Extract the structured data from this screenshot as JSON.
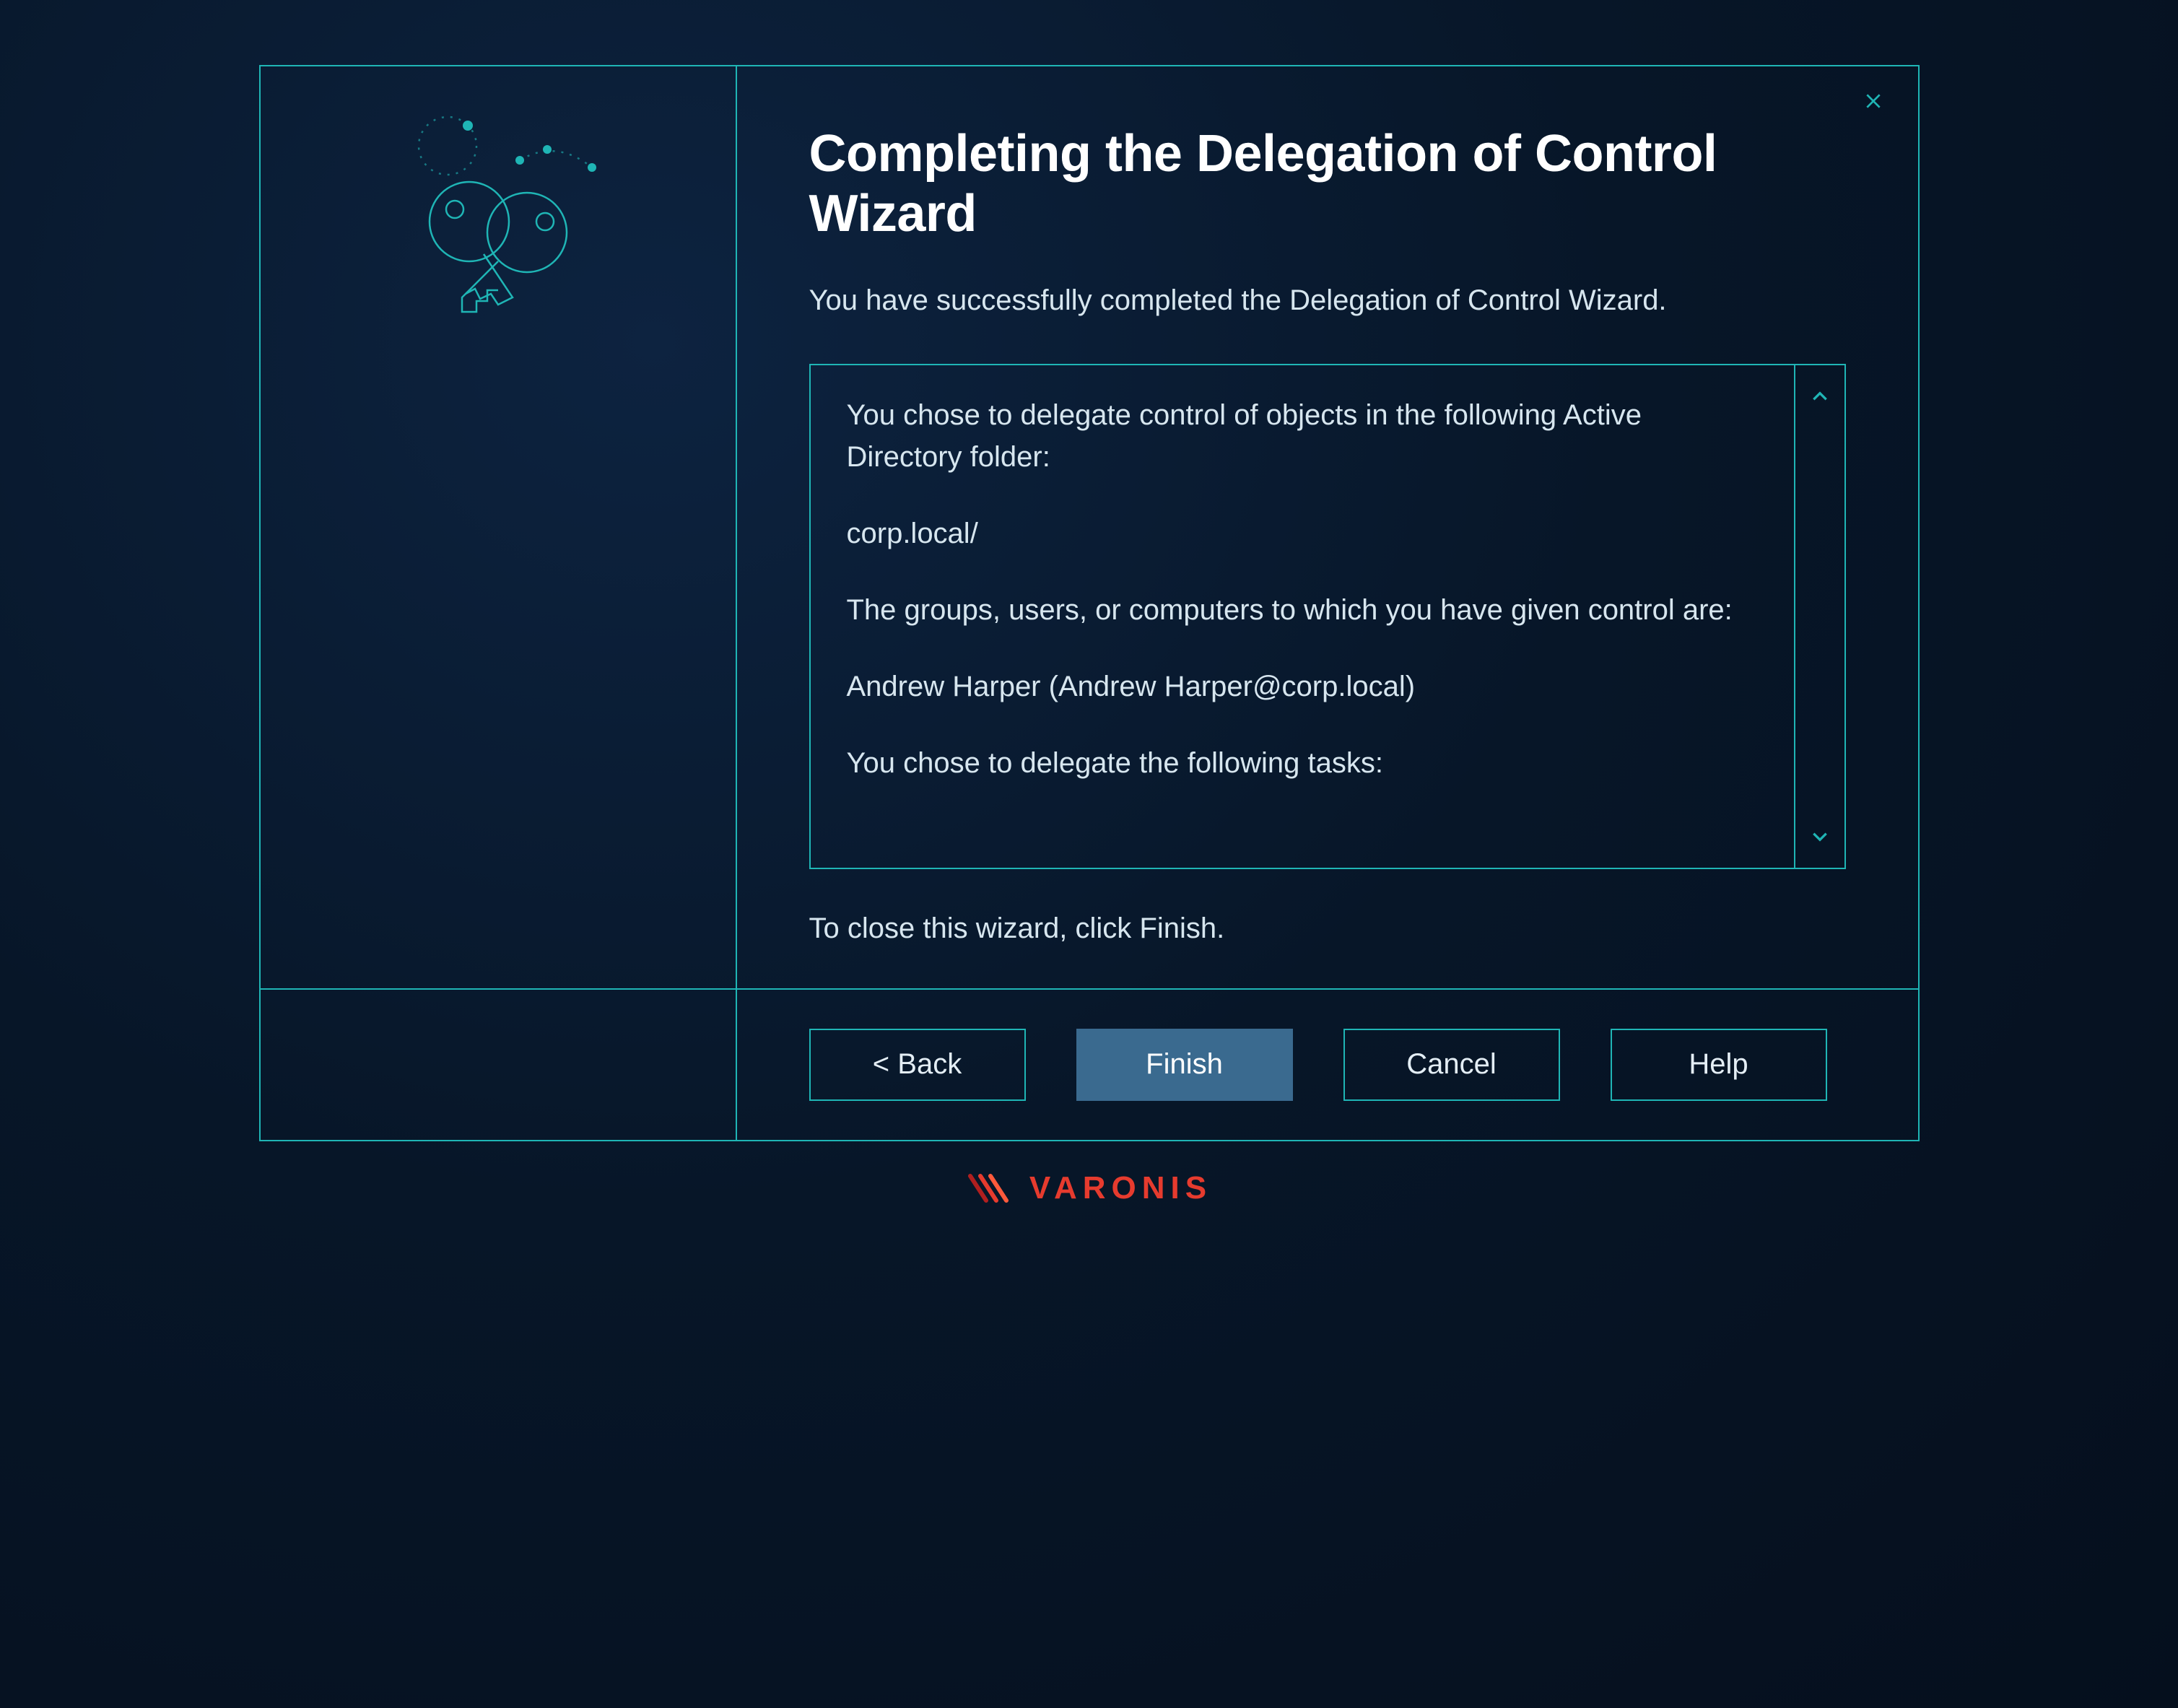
{
  "title": "Completing the Delegation of Control Wizard",
  "intro": "You have successfully completed the Delegation of Control Wizard.",
  "summary": {
    "line1": "You chose to delegate control of objects in the following Active Directory folder:",
    "folder": "corp.local/",
    "line2": "The groups, users, or computers to which you have given control are:",
    "principal": "Andrew Harper (Andrew Harper@corp.local)",
    "line3": "You chose to delegate the following tasks:"
  },
  "outro": "To close this wizard, click Finish.",
  "buttons": {
    "back": "< Back",
    "finish": "Finish",
    "cancel": "Cancel",
    "help": "Help"
  },
  "brand": "VARONIS"
}
